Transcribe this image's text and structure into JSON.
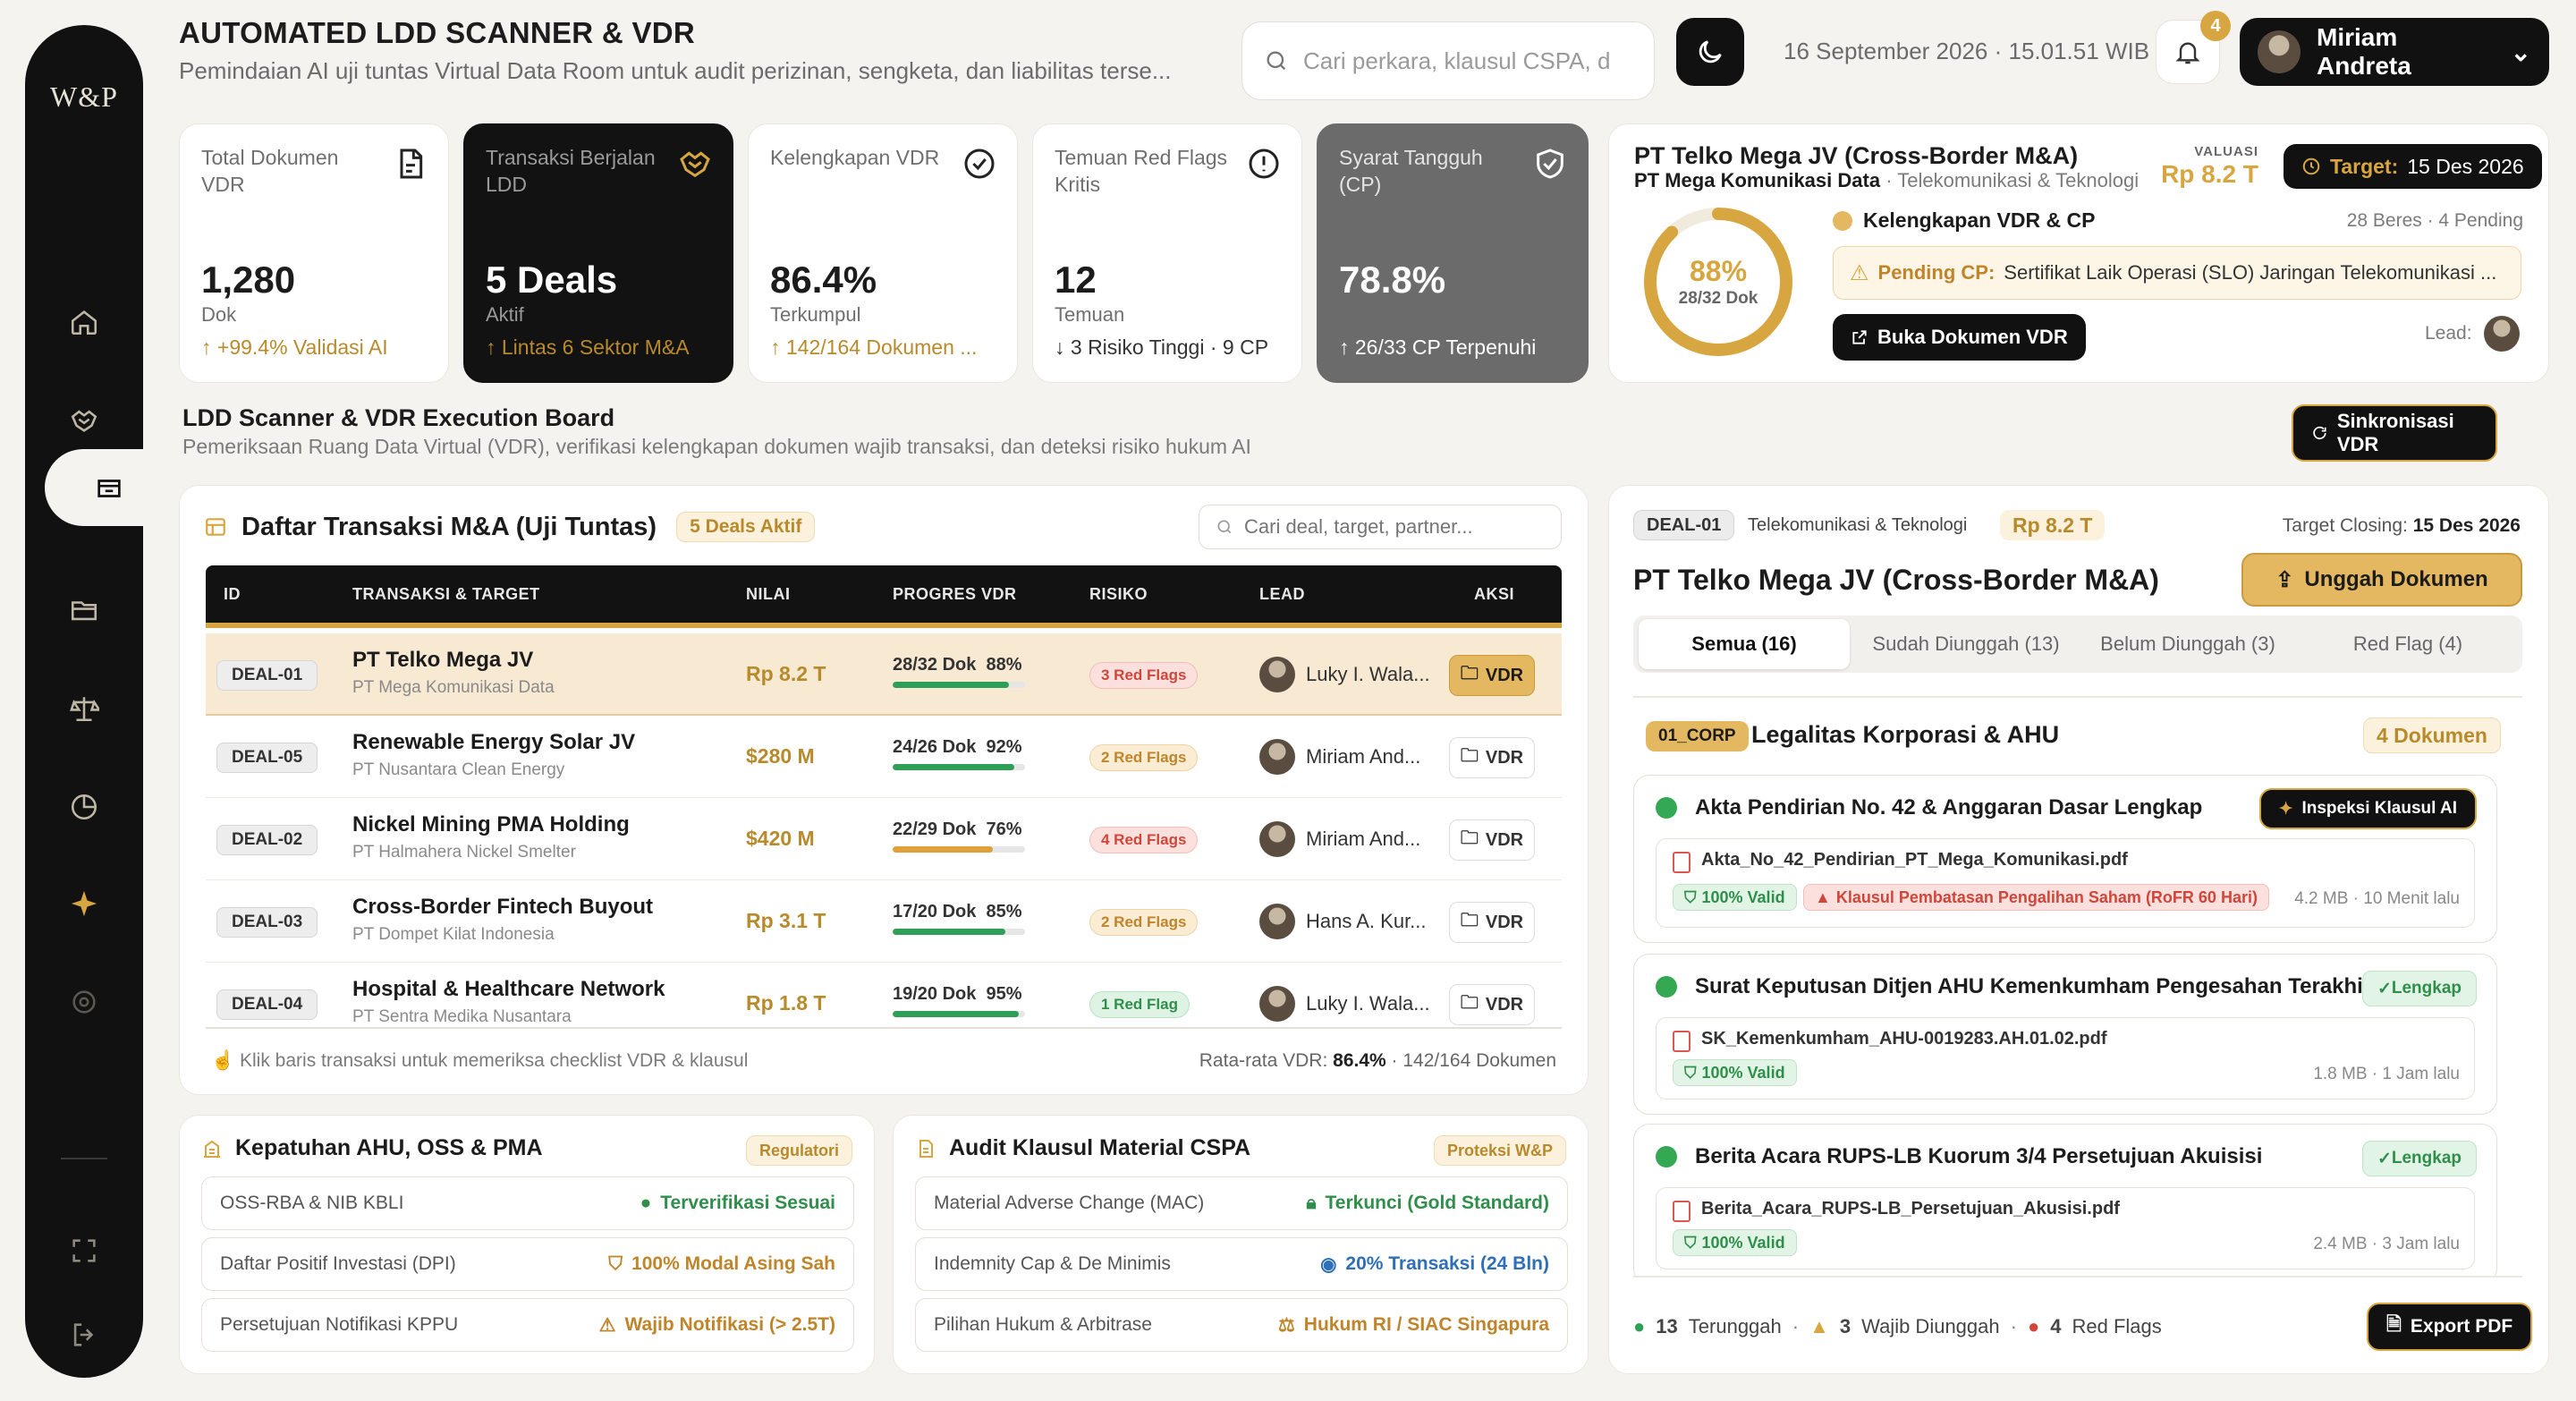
{
  "sidebar": {
    "logo": "W&P",
    "items": [
      "home",
      "deals",
      "vdr",
      "archive",
      "compliance",
      "analytics",
      "favorites",
      "settings"
    ]
  },
  "header": {
    "title": "AUTOMATED LDD SCANNER & VDR",
    "subtitle": "Pemindaian AI uji tuntas Virtual Data Room untuk audit perizinan, sengketa, dan liabilitas terse...",
    "search_placeholder": "Cari perkara, klausul CSPA, d",
    "datetime": "16 September 2026 · 15.01.51 WIB",
    "notif_count": "4",
    "user_name": "Miriam Andreta"
  },
  "kpis": [
    {
      "label": "Total Dokumen VDR",
      "value": "1,280",
      "unit": "Dok",
      "foot": "+99.4% Validasi AI"
    },
    {
      "label": "Transaksi Berjalan LDD",
      "value": "5 Deals",
      "unit": "Aktif",
      "foot": "Lintas 6 Sektor M&A"
    },
    {
      "label": "Kelengkapan VDR",
      "value": "86.4%",
      "unit": "Terkumpul",
      "foot": "142/164 Dokumen ..."
    },
    {
      "label": "Temuan Red Flags Kritis",
      "value": "12",
      "unit": "Temuan",
      "foot": "3 Risiko Tinggi · 9 CP"
    },
    {
      "label": "Syarat Tangguh (CP)",
      "value": "78.8%",
      "unit": "",
      "foot": "26/33 CP Terpenuhi"
    }
  ],
  "deal_summary": {
    "name": "PT Telko Mega JV (Cross-Border M&A)",
    "company": "PT Mega Komunikasi Data",
    "sector": "Telekomunikasi & Teknologi",
    "valuation_label": "VALUASI",
    "valuation": "Rp 8.2 T",
    "target_label": "Target:",
    "target": "15 Des 2026",
    "percent": "88%",
    "percent_value": 0.88,
    "docs": "28/32 Dok",
    "completeness_label": "Kelengkapan VDR & CP",
    "completeness_stats": "28 Beres · 4 Pending",
    "pending_label": "Pending CP:",
    "pending_text": "Sertifikat Laik Operasi (SLO) Jaringan Telekomunikasi ...",
    "open_button": "Buka Dokumen VDR",
    "lead_label": "Lead:"
  },
  "board": {
    "title": "LDD Scanner & VDR Execution Board",
    "subtitle": "Pemeriksaan Ruang Data Virtual (VDR), verifikasi kelengkapan dokumen wajib transaksi, dan deteksi risiko hukum AI",
    "sync_button": "Sinkronisasi VDR"
  },
  "deals_table": {
    "title": "Daftar Transaksi M&A (Uji Tuntas)",
    "badge": "5 Deals Aktif",
    "search_placeholder": "Cari deal, target, partner...",
    "columns": [
      "ID",
      "TRANSAKSI & TARGET",
      "NILAI",
      "PROGRES VDR",
      "RISIKO",
      "LEAD",
      "AKSI"
    ],
    "rows": [
      {
        "id": "DEAL-01",
        "name": "PT Telko Mega JV",
        "target": "PT Mega Komunikasi Data",
        "value": "Rp 8.2 T",
        "docs": "28/32 Dok",
        "pct": "88%",
        "progress": 0.88,
        "risk": "3 Red Flags",
        "lead": "Luky I. Wala...",
        "action": "VDR"
      },
      {
        "id": "DEAL-05",
        "name": "Renewable Energy Solar JV",
        "target": "PT Nusantara Clean Energy",
        "value": "$280 M",
        "docs": "24/26 Dok",
        "pct": "92%",
        "progress": 0.92,
        "risk": "2 Red Flags",
        "lead": "Miriam And...",
        "action": "VDR"
      },
      {
        "id": "DEAL-02",
        "name": "Nickel Mining PMA Holding",
        "target": "PT Halmahera Nickel Smelter",
        "value": "$420 M",
        "docs": "22/29 Dok",
        "pct": "76%",
        "progress": 0.76,
        "risk": "4 Red Flags",
        "lead": "Miriam And...",
        "action": "VDR"
      },
      {
        "id": "DEAL-03",
        "name": "Cross-Border Fintech Buyout",
        "target": "PT Dompet Kilat Indonesia",
        "value": "Rp 3.1 T",
        "docs": "17/20 Dok",
        "pct": "85%",
        "progress": 0.85,
        "risk": "2 Red Flags",
        "lead": "Hans A. Kur...",
        "action": "VDR"
      },
      {
        "id": "DEAL-04",
        "name": "Hospital & Healthcare Network",
        "target": "PT Sentra Medika Nusantara",
        "value": "Rp 1.8 T",
        "docs": "19/20 Dok",
        "pct": "95%",
        "progress": 0.95,
        "risk": "1 Red Flag",
        "lead": "Luky I. Wala...",
        "action": "VDR"
      }
    ],
    "hint": "Klik baris transaksi untuk memeriksa checklist VDR & klausul",
    "avg_label": "Rata-rata VDR:",
    "avg_value": "86.4%",
    "avg_docs": "· 142/164 Dokumen"
  },
  "compliance": {
    "title": "Kepatuhan AHU, OSS & PMA",
    "badge": "Regulatori",
    "items": [
      {
        "label": "OSS-RBA & NIB KBLI",
        "value": "Terverifikasi Sesuai"
      },
      {
        "label": "Daftar Positif Investasi (DPI)",
        "value": "100% Modal Asing Sah"
      },
      {
        "label": "Persetujuan Notifikasi KPPU",
        "value": "Wajib Notifikasi (> 2.5T)"
      }
    ]
  },
  "cspa": {
    "title": "Audit Klausul Material CSPA",
    "badge": "Proteksi W&P",
    "items": [
      {
        "label": "Material Adverse Change (MAC)",
        "value": "Terkunci (Gold Standard)"
      },
      {
        "label": "Indemnity Cap & De Minimis",
        "value": "20% Transaksi (24 Bln)"
      },
      {
        "label": "Pilihan Hukum & Arbitrase",
        "value": "Hukum RI / SIAC Singapura"
      }
    ]
  },
  "doc_panel": {
    "deal_id": "DEAL-01",
    "sector": "Telekomunikasi & Teknologi",
    "value": "Rp 8.2 T",
    "closing_label": "Target Closing:",
    "closing": "15 Des 2026",
    "title": "PT Telko Mega JV (Cross-Border M&A)",
    "upload_button": "Unggah Dokumen",
    "tabs": [
      "Semua (16)",
      "Sudah Diunggah (13)",
      "Belum Diunggah (3)",
      "Red Flag (4)"
    ],
    "section_code": "01_CORP",
    "section_title": "Legalitas Korporasi & AHU",
    "section_count": "4 Dokumen",
    "docs": [
      {
        "title": "Akta Pendirian No. 42 & Anggaran Dasar Lengkap",
        "action": "Inspeksi Klausul AI",
        "file": "Akta_No_42_Pendirian_PT_Mega_Komunikasi.pdf",
        "valid": "100% Valid",
        "flag": "Klausul Pembatasan Pengalihan Saham (RoFR 60 Hari)",
        "meta": "4.2 MB · 10 Menit lalu"
      },
      {
        "title": "Surat Keputusan Ditjen AHU Kemenkumham Pengesahan Terakhir",
        "status": "Lengkap",
        "file": "SK_Kemenkumham_AHU-0019283.AH.01.02.pdf",
        "valid": "100% Valid",
        "meta": "1.8 MB · 1 Jam lalu"
      },
      {
        "title": "Berita Acara RUPS-LB Kuorum 3/4 Persetujuan Akuisisi",
        "status": "Lengkap",
        "file": "Berita_Acara_RUPS-LB_Persetujuan_Akusisi.pdf",
        "valid": "100% Valid",
        "meta": "2.4 MB · 3 Jam lalu"
      }
    ],
    "footer": {
      "uploaded": "13",
      "uploaded_label": "Terunggah",
      "required": "3",
      "required_label": "Wajib Diunggah",
      "flags": "4",
      "flags_label": "Red Flags"
    },
    "export_button": "Export PDF"
  },
  "colors": {
    "accent_gold": "#d8a640",
    "dark": "#111111",
    "green": "#2f8f4a",
    "red": "#d0463b"
  }
}
